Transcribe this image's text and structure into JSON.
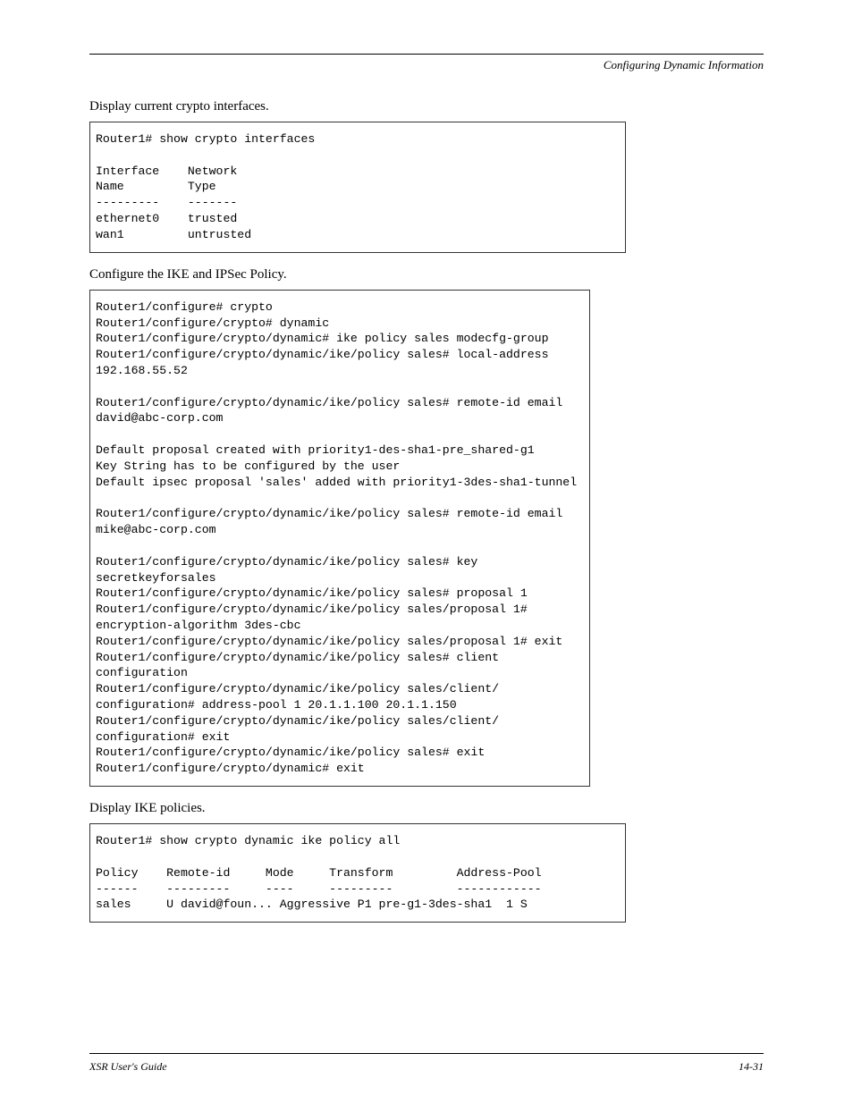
{
  "header": {
    "right": "Configuring Dynamic Information"
  },
  "sections": {
    "s1_title": "Display current crypto interfaces.",
    "s2_title": "Configure the IKE and IPSec Policy.",
    "s3_title": "Display IKE policies."
  },
  "code1": "Router1# show crypto interfaces\n\nInterface    Network\nName         Type\n---------    -------\nethernet0    trusted\nwan1         untrusted",
  "code2": "Router1/configure# crypto\nRouter1/configure/crypto# dynamic\nRouter1/configure/crypto/dynamic# ike policy sales modecfg-group\nRouter1/configure/crypto/dynamic/ike/policy sales# local-address\n192.168.55.52\n\nRouter1/configure/crypto/dynamic/ike/policy sales# remote-id email\ndavid@abc-corp.com\n\nDefault proposal created with priority1-des-sha1-pre_shared-g1\nKey String has to be configured by the user\nDefault ipsec proposal 'sales' added with priority1-3des-sha1-tunnel\n\nRouter1/configure/crypto/dynamic/ike/policy sales# remote-id email\nmike@abc-corp.com\n\nRouter1/configure/crypto/dynamic/ike/policy sales# key\nsecretkeyforsales\nRouter1/configure/crypto/dynamic/ike/policy sales# proposal 1\nRouter1/configure/crypto/dynamic/ike/policy sales/proposal 1#\nencryption-algorithm 3des-cbc\nRouter1/configure/crypto/dynamic/ike/policy sales/proposal 1# exit\nRouter1/configure/crypto/dynamic/ike/policy sales# client\nconfiguration\nRouter1/configure/crypto/dynamic/ike/policy sales/client/\nconfiguration# address-pool 1 20.1.1.100 20.1.1.150\nRouter1/configure/crypto/dynamic/ike/policy sales/client/\nconfiguration# exit\nRouter1/configure/crypto/dynamic/ike/policy sales# exit\nRouter1/configure/crypto/dynamic# exit",
  "code3": "Router1# show crypto dynamic ike policy all\n\nPolicy    Remote-id     Mode     Transform         Address-Pool\n------    ---------     ----     ---------         ------------\nsales     U david@foun... Aggressive P1 pre-g1-3des-sha1  1 S",
  "footer": {
    "left": "XSR User's Guide",
    "right": "14-31"
  }
}
